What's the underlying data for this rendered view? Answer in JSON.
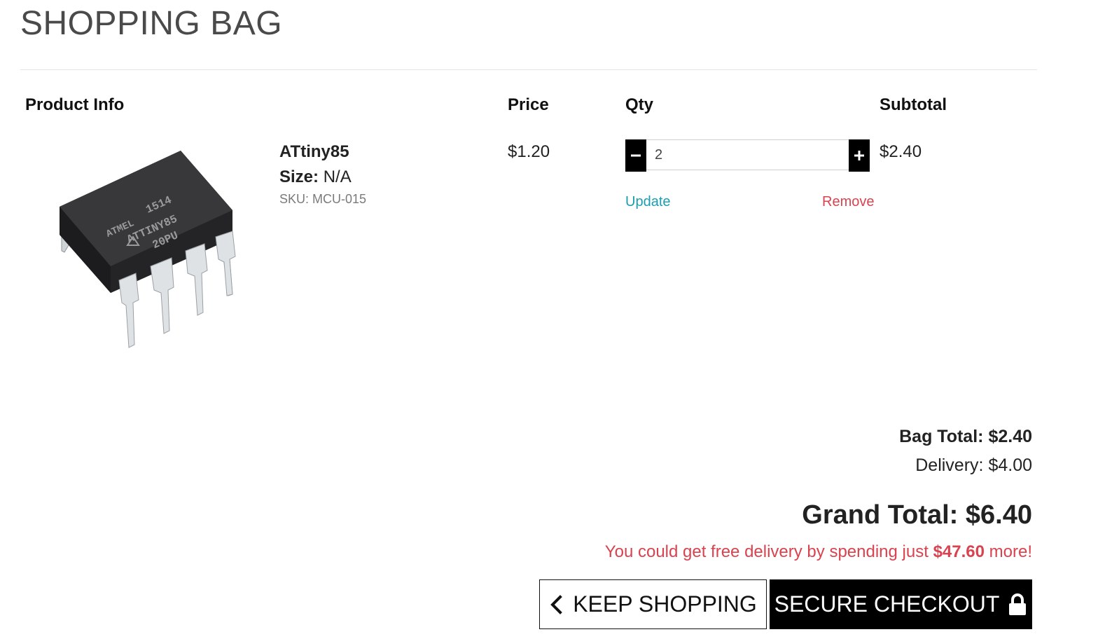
{
  "page": {
    "title": "SHOPPING BAG"
  },
  "table": {
    "headers": {
      "product_info": "Product Info",
      "price": "Price",
      "qty": "Qty",
      "subtotal": "Subtotal"
    }
  },
  "item": {
    "name": "ATtiny85",
    "size_label": "Size:",
    "size_value": "N/A",
    "sku": "SKU: MCU-015",
    "price": "$1.20",
    "qty": "2",
    "subtotal": "$2.40",
    "update_label": "Update",
    "remove_label": "Remove",
    "chip_marking": [
      "1514",
      "ATTINY85",
      "20PU"
    ],
    "chip_logo": "ATMEL"
  },
  "summary": {
    "bag_total_label": "Bag Total:",
    "bag_total_value": "$2.40",
    "delivery_label": "Delivery:",
    "delivery_value": "$4.00",
    "grand_total_label": "Grand Total:",
    "grand_total_value": "$6.40",
    "free_delivery_prefix": "You could get free delivery by spending just",
    "free_delivery_amount": "$47.60",
    "free_delivery_suffix": "more!"
  },
  "actions": {
    "keep_shopping_label": "KEEP SHOPPING",
    "checkout_label": "SECURE CHECKOUT"
  },
  "icons": {
    "minus": "minus-icon",
    "plus": "plus-icon",
    "chevron_left": "chevron-left-icon",
    "lock": "lock-icon"
  },
  "colors": {
    "link_teal": "#1a9fb0",
    "alert_red": "#d9434f",
    "button_black": "#000000"
  }
}
